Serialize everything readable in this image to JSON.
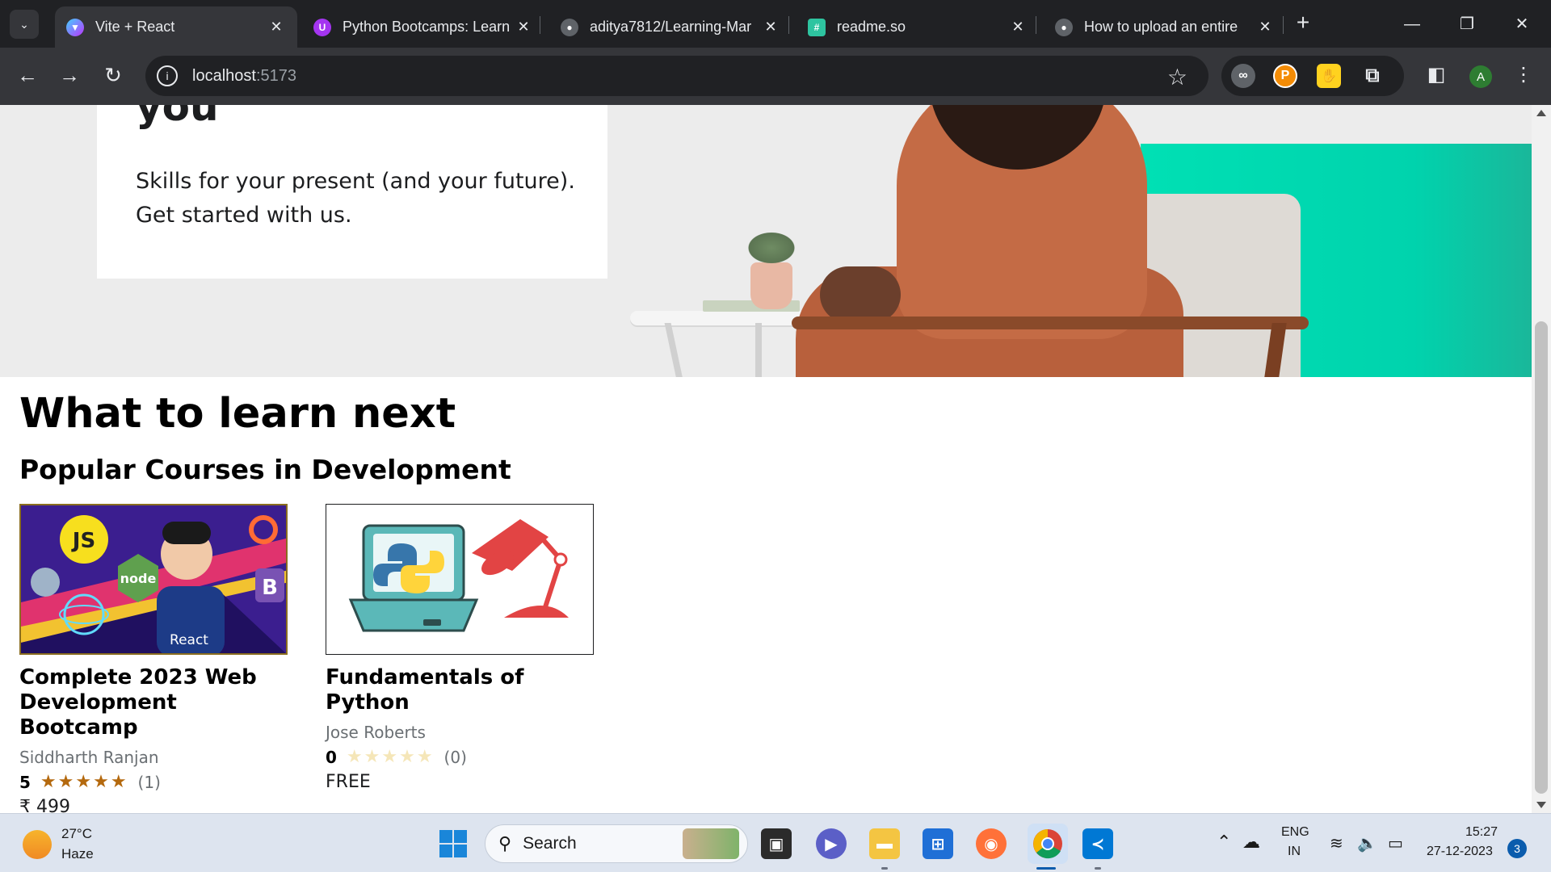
{
  "browser": {
    "tabs": [
      {
        "title": "Vite + React",
        "favicon": "vite-icon",
        "active": true
      },
      {
        "title": "Python Bootcamps: Learn",
        "favicon": "udemy-icon",
        "active": false
      },
      {
        "title": "aditya7812/Learning-Mar",
        "favicon": "github-icon",
        "active": false
      },
      {
        "title": "readme.so",
        "favicon": "readme-icon",
        "active": false
      },
      {
        "title": "How to upload an entire",
        "favicon": "github-icon",
        "active": false
      }
    ],
    "url_host": "localhost",
    "url_port": ":5173",
    "profile_initial": "A",
    "colors": {
      "frame": "#202124",
      "toolbar": "#35363a",
      "text": "#e8eaed"
    }
  },
  "page": {
    "hero": {
      "heading": "you",
      "subtitle": "Skills for your present (and your future). Get started with us."
    },
    "section_title": "What to learn next",
    "section_subtitle": "Popular Courses in Development",
    "courses": [
      {
        "title": "Complete 2023 Web Development Bootcamp",
        "instructor": "Siddharth Ranjan",
        "rating": "5",
        "stars": "★★★★★",
        "rating_count": "(1)",
        "price": "₹ 499",
        "star_color": "#b4690e",
        "thumb_labels": {
          "js": "JS",
          "node": "node",
          "react": "React",
          "bootstrap": "B"
        }
      },
      {
        "title": "Fundamentals of Python",
        "instructor": "Jose Roberts",
        "rating": "0",
        "stars": "★★★★★",
        "rating_count": "(0)",
        "price": "FREE",
        "star_color": "#f5e6b8"
      }
    ]
  },
  "taskbar": {
    "weather_temp": "27°C",
    "weather_desc": "Haze",
    "search_label": "Search",
    "lang_top": "ENG",
    "lang_bottom": "IN",
    "time": "15:27",
    "date": "27-12-2023",
    "notification_count": "3"
  }
}
